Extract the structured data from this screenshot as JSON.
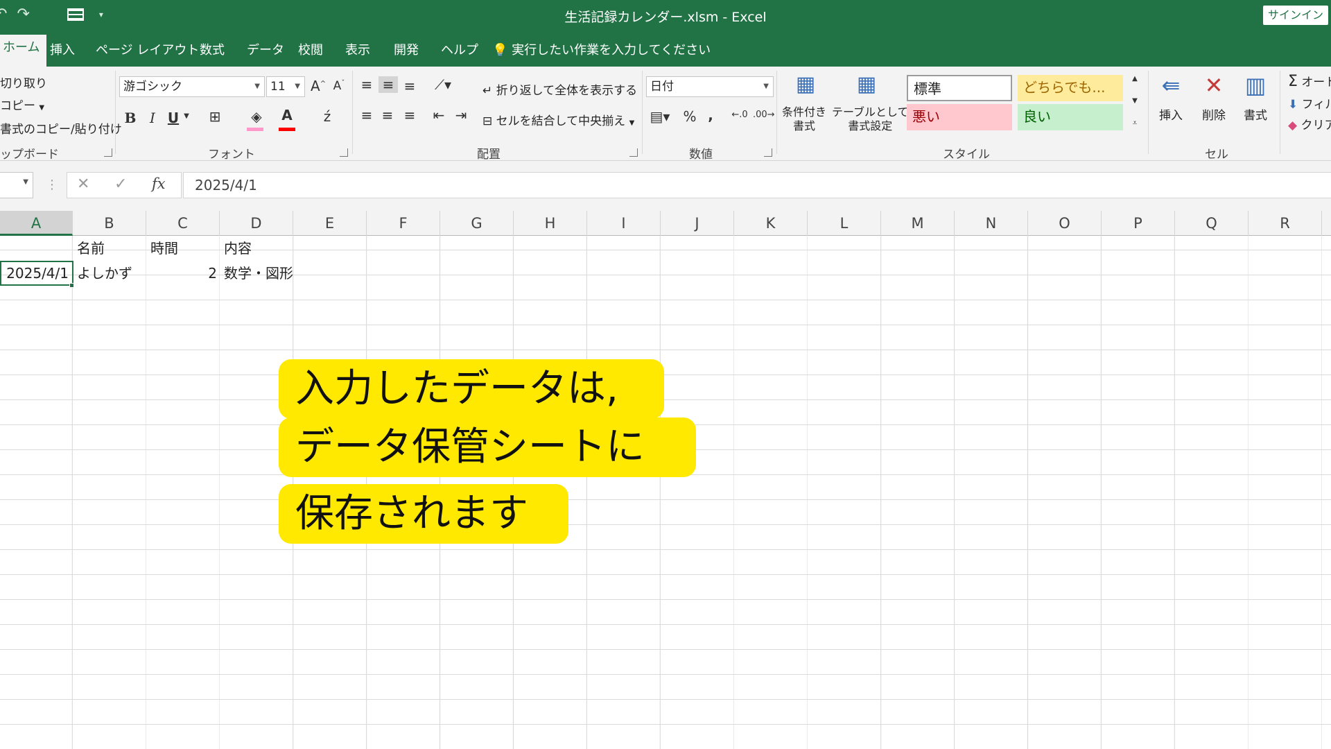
{
  "window": {
    "title": "生活記録カレンダー.xlsm  -  Excel",
    "signin": "サインイン"
  },
  "tabs": [
    "ホーム",
    "挿入",
    "ページ レイアウト",
    "数式",
    "データ",
    "校閲",
    "表示",
    "開発",
    "ヘルプ"
  ],
  "tell_me": "実行したい作業を入力してください",
  "clipboard": {
    "cut": "切り取り",
    "copy": "コピー",
    "format_painter": "書式のコピー/貼り付け",
    "group": "ップボード"
  },
  "font": {
    "name": "游ゴシック",
    "size": "11",
    "group": "フォント",
    "bold": "B",
    "italic": "I",
    "underline": "U",
    "grow": "A",
    "shrink": "A",
    "color_letter": "A"
  },
  "alignment": {
    "wrap_text": "折り返して全体を表示する",
    "merge_center": "セルを結合して中央揃え",
    "group": "配置"
  },
  "number": {
    "format": "日付",
    "percent": "%",
    "comma": ",",
    "group": "数値"
  },
  "styles": {
    "conditional": "条件付き\n書式",
    "table": "テーブルとして\n書式設定",
    "normal": "標準",
    "neutral": "どちらでも...",
    "bad": "悪い",
    "good": "良い",
    "group": "スタイル",
    "colors": {
      "neutral_bg": "#ffeb9c",
      "neutral_fg": "#9c6500",
      "bad_bg": "#ffc7ce",
      "bad_fg": "#9c0006",
      "good_bg": "#c6efce",
      "good_fg": "#006100"
    }
  },
  "cells_group": {
    "insert": "挿入",
    "delete": "削除",
    "format": "書式",
    "group": "セル"
  },
  "editing": {
    "autosum": "オート",
    "fill": "フィル",
    "clear": "クリア"
  },
  "formula_bar": {
    "fx": "fx",
    "value": "2025/4/1"
  },
  "columns": [
    "A",
    "B",
    "C",
    "D",
    "E",
    "F",
    "G",
    "H",
    "I",
    "J",
    "K",
    "L",
    "M",
    "N",
    "O",
    "P",
    "Q",
    "R"
  ],
  "sheet": {
    "header_row": {
      "B": "名前",
      "C": "時間",
      "D": "内容"
    },
    "data_row": {
      "A": "2025/4/1",
      "B": "よしかず",
      "C": "2",
      "D": "数学・図形"
    }
  },
  "callout": {
    "line1": "入力したデータは,",
    "line2": "データ保管シートに",
    "line3": "保存されます"
  },
  "theme": {
    "excel_green": "#217346",
    "callout_yellow": "#ffe900"
  }
}
